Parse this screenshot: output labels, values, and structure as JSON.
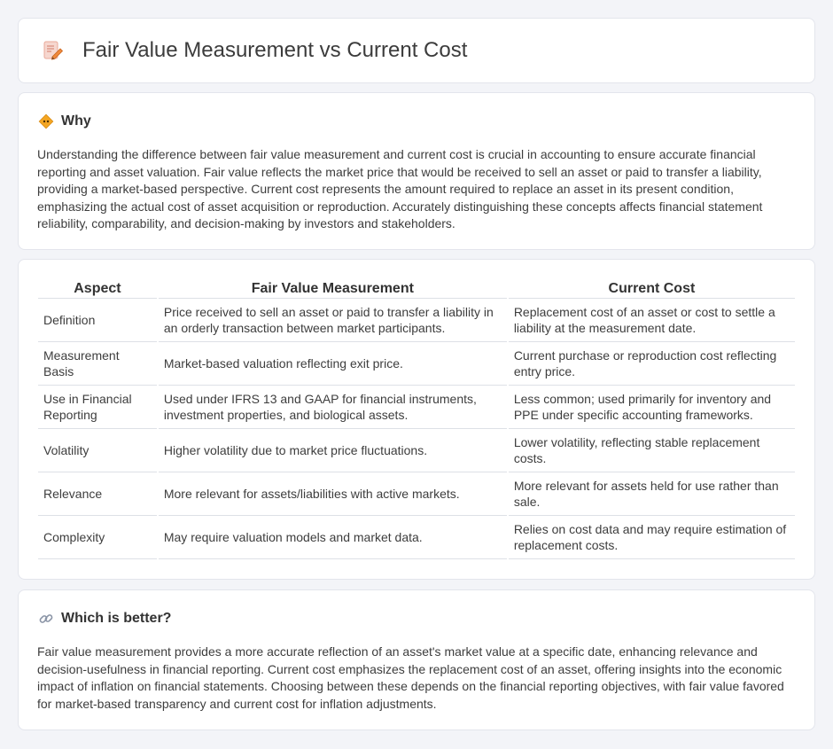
{
  "header": {
    "title": "Fair Value Measurement vs Current Cost",
    "icon": "document-pencil-icon"
  },
  "why": {
    "title": "Why",
    "icon": "diamond-warning-icon",
    "text": "Understanding the difference between fair value measurement and current cost is crucial in accounting to ensure accurate financial reporting and asset valuation. Fair value reflects the market price that would be received to sell an asset or paid to transfer a liability, providing a market-based perspective. Current cost represents the amount required to replace an asset in its present condition, emphasizing the actual cost of asset acquisition or reproduction. Accurately distinguishing these concepts affects financial statement reliability, comparability, and decision-making by investors and stakeholders."
  },
  "table": {
    "headers": [
      "Aspect",
      "Fair Value Measurement",
      "Current Cost"
    ],
    "rows": [
      [
        "Definition",
        "Price received to sell an asset or paid to transfer a liability in an orderly transaction between market participants.",
        "Replacement cost of an asset or cost to settle a liability at the measurement date."
      ],
      [
        "Measurement Basis",
        "Market-based valuation reflecting exit price.",
        "Current purchase or reproduction cost reflecting entry price."
      ],
      [
        "Use in Financial Reporting",
        "Used under IFRS 13 and GAAP for financial instruments, investment properties, and biological assets.",
        "Less common; used primarily for inventory and PPE under specific accounting frameworks."
      ],
      [
        "Volatility",
        "Higher volatility due to market price fluctuations.",
        "Lower volatility, reflecting stable replacement costs."
      ],
      [
        "Relevance",
        "More relevant for assets/liabilities with active markets.",
        "More relevant for assets held for use rather than sale."
      ],
      [
        "Complexity",
        "May require valuation models and market data.",
        "Relies on cost data and may require estimation of replacement costs."
      ]
    ]
  },
  "better": {
    "title": "Which is better?",
    "icon": "link-icon",
    "text": "Fair value measurement provides a more accurate reflection of an asset's market value at a specific date, enhancing relevance and decision-usefulness in financial reporting. Current cost emphasizes the replacement cost of an asset, offering insights into the economic impact of inflation on financial statements. Choosing between these depends on the financial reporting objectives, with fair value favored for market-based transparency and current cost for inflation adjustments."
  }
}
